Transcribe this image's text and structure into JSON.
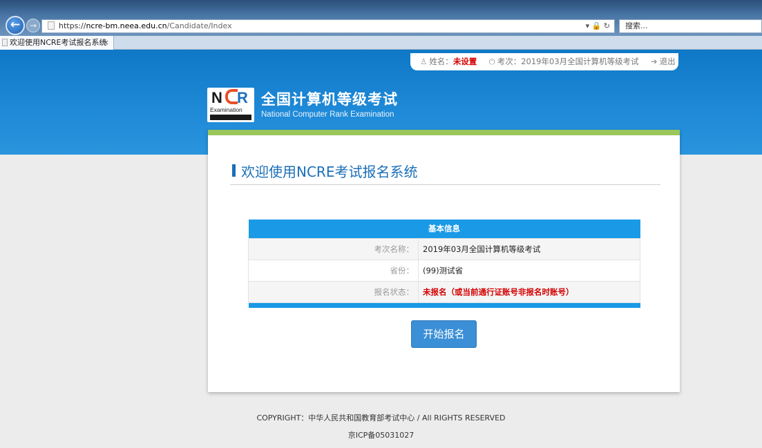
{
  "browser": {
    "address_prefix": "https://",
    "address_host": "ncre-bm.neea.edu.cn",
    "address_path": "/Candidate/Index",
    "address_controls": "▾ 🔒 ↻",
    "search_placeholder": "搜索...",
    "tab_title": "欢迎使用NCRE考试报名系统",
    "tab_close": "×"
  },
  "user_bar": {
    "name_label": "姓名：",
    "name_value": "未设置",
    "exam_label": "考次：",
    "exam_value": "2019年03月全国计算机等级考试",
    "logout_label": "退出"
  },
  "header": {
    "logo_n": "N",
    "logo_r": "R",
    "logo_sub": "Examination",
    "title": "全国计算机等级考试",
    "subtitle": "National Computer Rank Examination"
  },
  "main": {
    "welcome": "欢迎使用NCRE考试报名系统",
    "table_title": "基本信息",
    "rows": [
      {
        "label": "考次名称：",
        "value": "2019年03月全国计算机等级考试"
      },
      {
        "label": "省份：",
        "value": "(99)测试省"
      },
      {
        "label": "报名状态：",
        "value": "未报名（或当前通行证账号非报名时账号）"
      }
    ],
    "start_button": "开始报名"
  },
  "footer": {
    "copyright": "COPYRIGHT：中华人民共和国教育部考试中心 / All RIGHTS RESERVED",
    "icp": "京ICP备05031027"
  },
  "colors": {
    "header_blue": "#1a86d6",
    "accent_green": "#9bc65a",
    "table_blue": "#1a9ae6",
    "warning_red": "#d40000"
  }
}
